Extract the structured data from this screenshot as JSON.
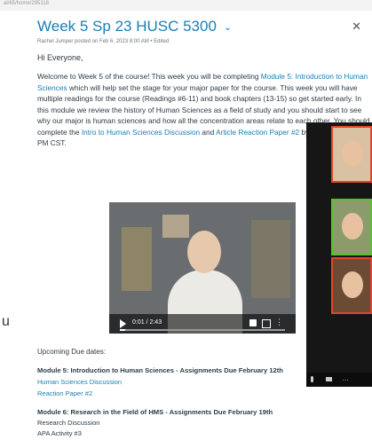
{
  "browser": {
    "url": "al/65/home/295118"
  },
  "left_panel": {
    "letter": "u"
  },
  "post": {
    "title": "Week 5 Sp 23 HUSC 5300",
    "meta": "Rachel Jumper posted on Feb 6, 2023 8:00 AM  •  Edited",
    "greeting": "Hi Everyone,",
    "p1": "Welcome to Week 5 of the course!  This week you will be completing ",
    "link_module5": "Module 5: Introduction to Human Sciences",
    "p2": " which will help set the stage for your major paper for the course.  This week you will have multiple readings for the course (Readings #6-11) and book chapters (13-15) so get started early.  In this module we review the history of Human Sciences as a field of study and you should start to see why our major is human sciences and how all the concentration areas relate to each other.  You should complete the ",
    "link_intro": "Intro to Human Sciences Discussion",
    "p3": " and ",
    "link_article": "Article Reaction Paper #2",
    "p4": " by Sunday at 11:59 PM CST.",
    "upcoming_label": "Upcoming Due dates:",
    "module5_header": "Module 5: Introduction to Human Sciences - Assignments Due February 12th",
    "module5_links": [
      "Human Sciences Discussion",
      "Reaction Paper #2"
    ],
    "module6_header": "Module 6: Research in the Field of HMS - Assignments Due February 19th",
    "module6_items": [
      "Research Discussion",
      "APA Activity #3"
    ]
  },
  "video": {
    "time": "0:01 / 2:43",
    "progress": 0.03
  },
  "icons": {
    "close": "close-icon",
    "chevron": "chevron-down-icon",
    "play": "play-icon",
    "volume": "volume-icon",
    "fullscreen": "fullscreen-icon",
    "mic": "mic-icon",
    "camera": "camera-icon",
    "more": "more-icon"
  },
  "colors": {
    "link": "#1a7fb4",
    "text": "#2d3b45",
    "zoom_bg": "#161616",
    "speaker_border": "#58c22e",
    "tile_border": "#e0452c"
  }
}
